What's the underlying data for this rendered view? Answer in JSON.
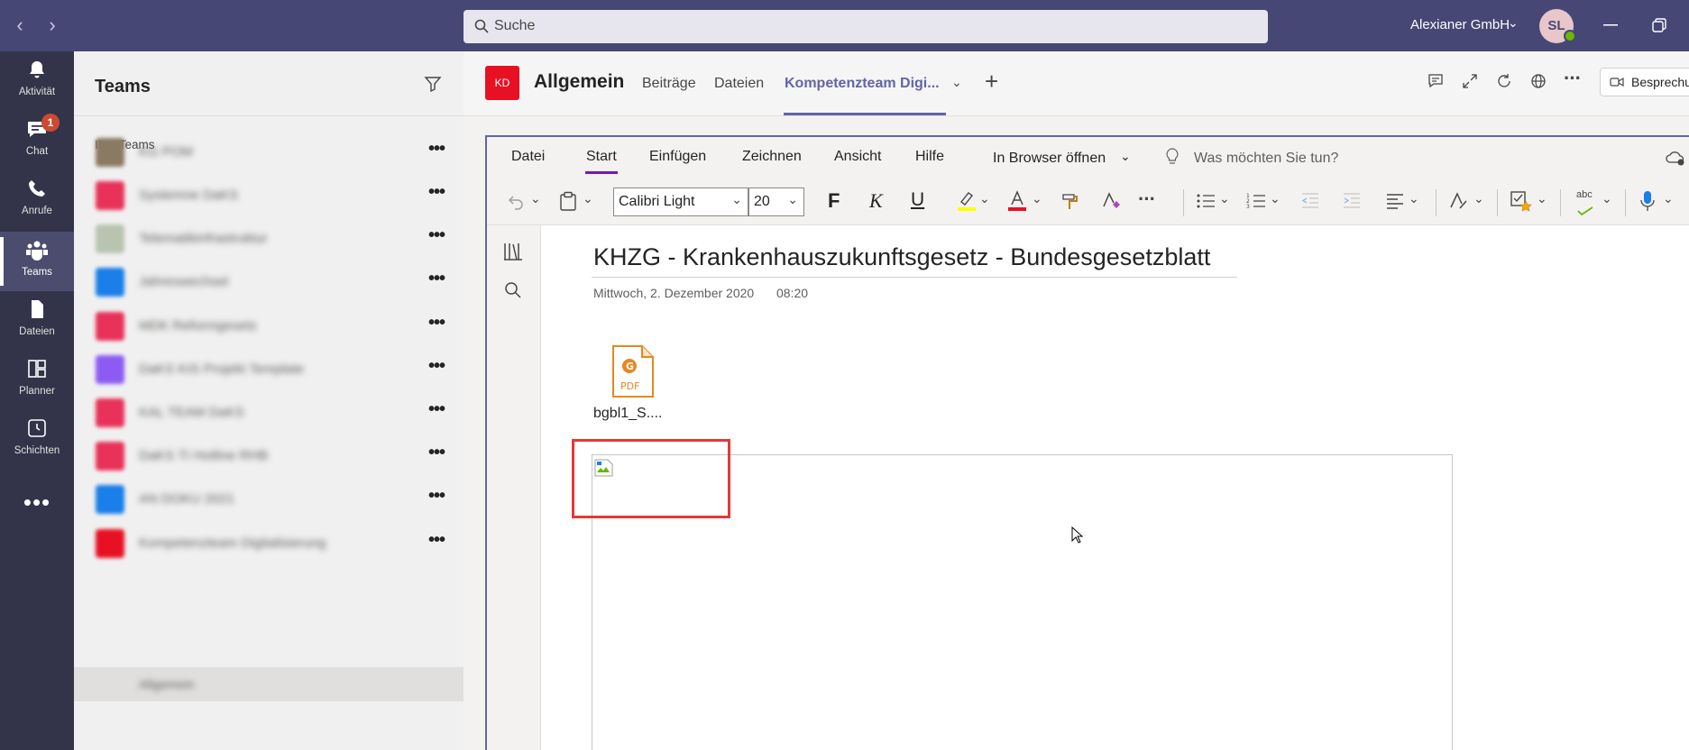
{
  "titlebar": {
    "back": "‹",
    "forward": "›",
    "search_placeholder": "Suche",
    "org": "Alexianer GmbH",
    "avatar_initials": "SL"
  },
  "rail": {
    "items": [
      {
        "label": "Aktivität",
        "icon": "bell-icon"
      },
      {
        "label": "Chat",
        "icon": "chat-icon",
        "badge": "1"
      },
      {
        "label": "Anrufe",
        "icon": "phone-icon"
      },
      {
        "label": "Teams",
        "icon": "teams-icon",
        "active": true
      },
      {
        "label": "Dateien",
        "icon": "file-icon"
      },
      {
        "label": "Planner",
        "icon": "planner-icon"
      },
      {
        "label": "Schichten",
        "icon": "clock-icon"
      }
    ],
    "more": "•••"
  },
  "teams_panel": {
    "title": "Teams",
    "section": "Ihre Teams",
    "teams": [
      {
        "name": "KG POM",
        "color": "#8a7a62"
      },
      {
        "name": "Systemne DaKS",
        "color": "#e8325a"
      },
      {
        "name": "Telematikinfrastruktur",
        "color": "#b8c4b0"
      },
      {
        "name": "Jahreswechsel",
        "color": "#1a7fe8"
      },
      {
        "name": "MDK Reformgesetz",
        "color": "#e8325a"
      },
      {
        "name": "DaKS KIS Projekt Template",
        "color": "#8c5cf2"
      },
      {
        "name": "KAL TEAM DaKS",
        "color": "#e8325a"
      },
      {
        "name": "DaKS TI Hotline RHB",
        "color": "#e8325a"
      },
      {
        "name": "AN DOKU 2021",
        "color": "#1a7fe8"
      },
      {
        "name": "Kompetenzteam Digitalisierung",
        "color": "#e81123"
      }
    ],
    "channel": "Allgemein",
    "more": "•••"
  },
  "channel_header": {
    "tile": "KD",
    "title": "Allgemein",
    "tabs": [
      "Beiträge",
      "Dateien",
      "Kompetenzteam Digi..."
    ],
    "add_tab": "+",
    "meet_label": "Besprechu"
  },
  "onenote": {
    "ribbon_tabs": [
      "Datei",
      "Start",
      "Einfügen",
      "Zeichnen",
      "Ansicht",
      "Hilfe"
    ],
    "open_in_browser": "In Browser öffnen",
    "tell_me": "Was möchten Sie tun?",
    "font_name": "Calibri Light",
    "font_size": "20",
    "bold": "F",
    "italic": "K",
    "underline": "U",
    "more": "···",
    "spell": "abc",
    "page_title": "KHZG - Krankenhauszukunftsgesetz - Bundesgesetzblatt",
    "page_date": "Mittwoch, 2. Dezember 2020",
    "page_time": "08:20",
    "attachment_name": "bgbl1_S....",
    "pdf_label": "PDF"
  },
  "colors": {
    "titlebar": "#464775",
    "rail": "#33344a",
    "accent": "#6264a7",
    "onenote_accent": "#7719aa",
    "highlight": "#e53935"
  }
}
